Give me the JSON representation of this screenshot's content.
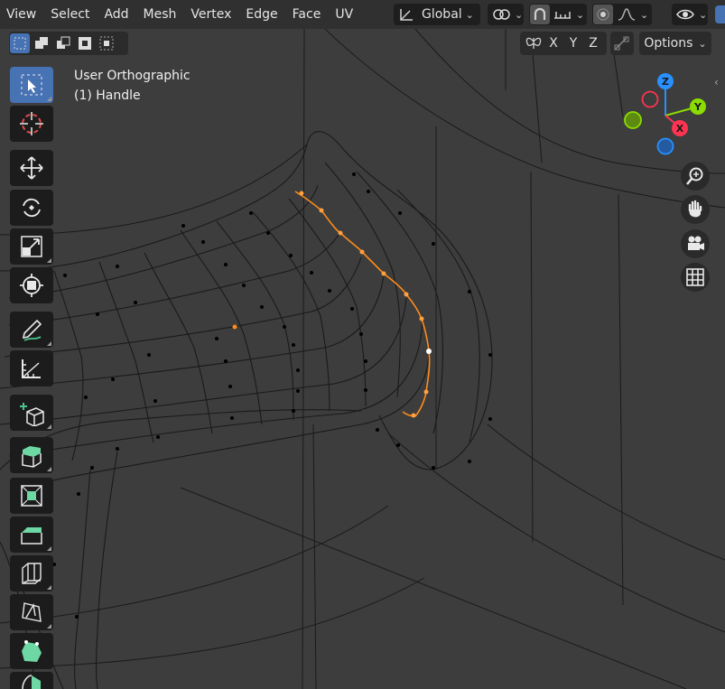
{
  "menu": [
    "View",
    "Select",
    "Add",
    "Mesh",
    "Vertex",
    "Edge",
    "Face",
    "UV"
  ],
  "transform_orientation": "Global",
  "axis_buttons": [
    "X",
    "Y",
    "Z"
  ],
  "options_label": "Options",
  "viewport_info": {
    "view_name": "User Orthographic",
    "object_name": "(1) Handle"
  },
  "gizmo_axes": {
    "z": "Z",
    "y": "Y",
    "x": "X"
  },
  "colors": {
    "accent": "#4772b3",
    "selection": "#ff8c1a",
    "x_axis": "#ff3352",
    "y_axis": "#8bdc00",
    "z_axis": "#2890ff"
  },
  "tools": [
    "select-box",
    "cursor",
    "move",
    "rotate",
    "scale",
    "transform",
    "annotate",
    "measure",
    "add-cube",
    "extrude-region",
    "inset-faces",
    "bevel",
    "loop-cut",
    "knife",
    "poly-build",
    "spin"
  ],
  "select_modes": [
    "new",
    "extend",
    "subtract",
    "invert",
    "intersect"
  ]
}
